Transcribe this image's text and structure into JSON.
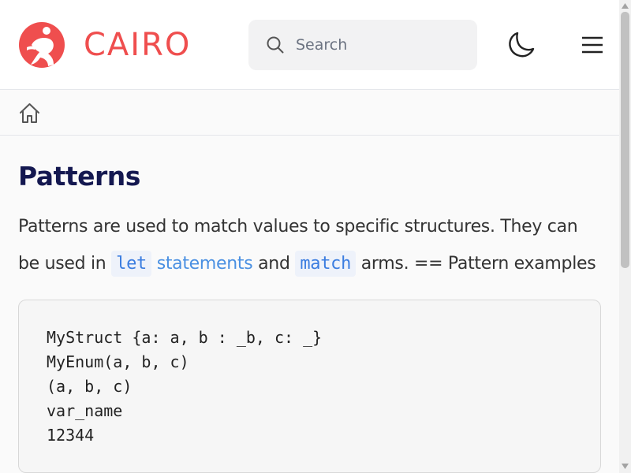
{
  "header": {
    "logo_text": "CAIRO",
    "search": {
      "placeholder": "Search"
    }
  },
  "colors": {
    "brand": "#ef4e4e",
    "title": "#141850",
    "link": "#4a90e2"
  },
  "icons": {
    "logo": "cairo-runner-logo",
    "search": "search-icon",
    "theme": "moon-icon",
    "menu": "hamburger-menu-icon",
    "home": "home-icon"
  },
  "main": {
    "title": "Patterns",
    "paragraph": {
      "part1": "Patterns are used to match values to specific structures. They can be used in ",
      "code1": "let",
      "link": "statements",
      "part2": " and ",
      "code2": "match",
      "part3": " arms. == Pattern examples"
    },
    "code_lines": [
      "MyStruct {a: a, b : _b, c: _}",
      "MyEnum(a, b, c)",
      "(a, b, c)",
      "var_name",
      "12344"
    ]
  }
}
